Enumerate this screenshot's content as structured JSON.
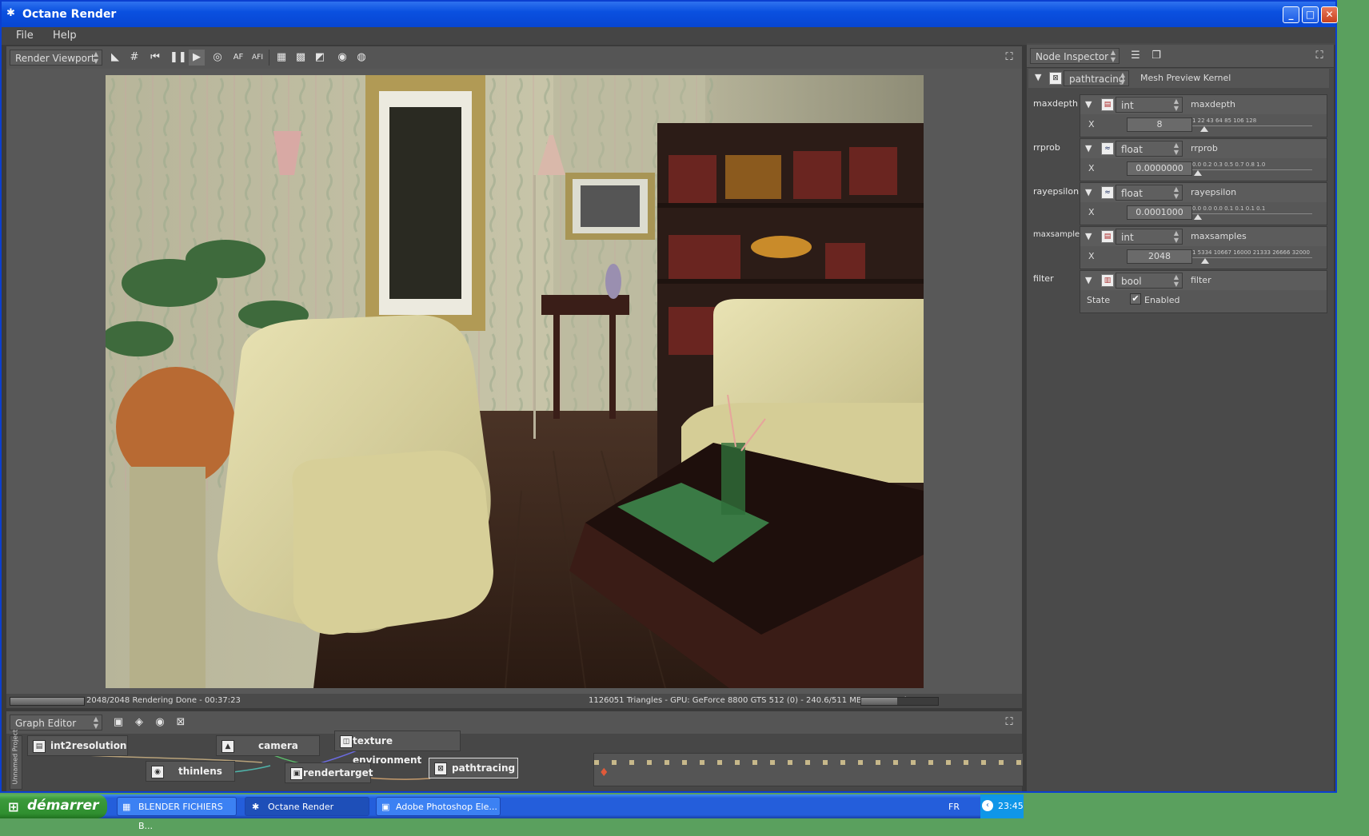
{
  "window": {
    "title": "Octane Render",
    "controls": {
      "minimize": "minimize-icon",
      "maximize": "maximize-icon",
      "close": "close-icon"
    }
  },
  "menu": [
    "File",
    "Help"
  ],
  "viewport": {
    "dropdown": "Render Viewport",
    "tools": [
      "set-focus-icon",
      "grid-icon",
      "restart-icon",
      "pause-icon",
      "play-icon",
      "recenter-icon",
      "AF",
      "AFI",
      "region-icon",
      "checker-icon",
      "film-icon",
      "lock-icon",
      "camera-reset-icon"
    ],
    "tool_text": {
      "af": "AF",
      "afi": "AFI"
    },
    "status_left": "2048/2048 Rendering Done - 00:37:23",
    "status_right": "1126051 Triangles - GPU: GeForce 8800 GTS 512 (0) - 240.6/511 MB Mem Used",
    "progress": 1.0,
    "mem_used_fraction": 0.47
  },
  "inspector": {
    "dropdown": "Node Inspector",
    "node_type": "pathtracing",
    "node_name": "Mesh Preview Kernel",
    "params": [
      {
        "label": "maxdepth",
        "type": "int",
        "name": "maxdepth",
        "axis": "X",
        "value": "8",
        "scale": "1  22  43  64  85  106  128",
        "pos": 0.05
      },
      {
        "label": "rrprob",
        "type": "float",
        "name": "rrprob",
        "axis": "X",
        "value": "0.0000000",
        "scale": "0.0  0.2  0.3  0.5  0.7  0.8  1.0",
        "pos": 0.0
      },
      {
        "label": "rayepsilon",
        "type": "float",
        "name": "rayepsilon",
        "axis": "X",
        "value": "0.0001000",
        "scale": "0.0  0.0  0.0  0.1  0.1  0.1  0.1",
        "pos": 0.0
      },
      {
        "label": "maxsamples",
        "type": "int",
        "name": "maxsamples",
        "axis": "X",
        "value": "2048",
        "scale": "1  5334 10667 16000 21333 26666 32000",
        "pos": 0.06
      }
    ],
    "filter": {
      "label": "filter",
      "type": "bool",
      "name": "filter",
      "state_label": "State",
      "state_value": "Enabled",
      "checked": true
    }
  },
  "graph": {
    "dropdown": "Graph Editor",
    "side_label": "Unnamed Project",
    "nodes": [
      "int2resolution",
      "camera",
      "texture environment",
      "thinlens",
      "rendertarget",
      "pathtracing"
    ]
  },
  "taskbar": {
    "start": "démarrer",
    "items": [
      "BLENDER FICHIERS B...",
      "Octane Render",
      "Adobe Photoshop Ele..."
    ],
    "lang": "FR",
    "clock": "23:45"
  },
  "colors": {
    "titlebar": "#0a50e0",
    "panel": "#4a4a4a",
    "desktop": "#5aa05e",
    "taskbar": "#245edb",
    "start": "#3c9a3c"
  }
}
